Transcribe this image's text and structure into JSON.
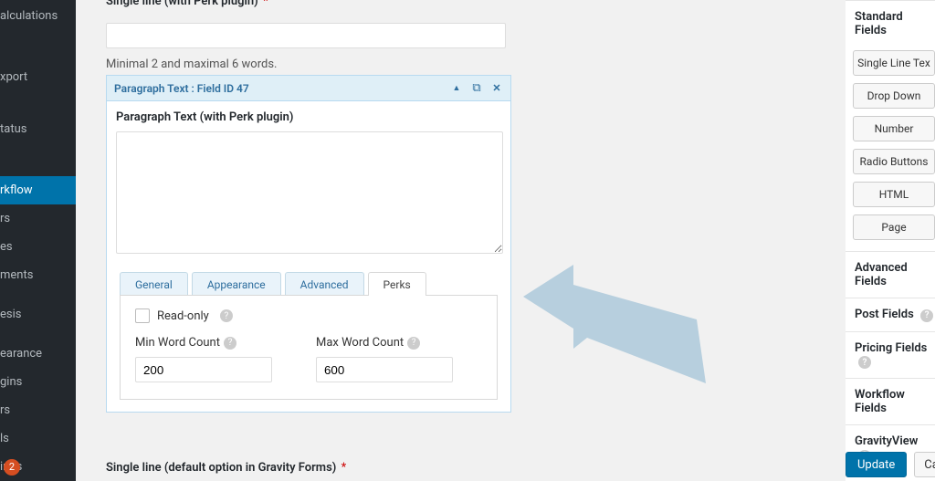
{
  "admin_menu": {
    "items": [
      {
        "label": "alculations"
      },
      {
        "label": "xport"
      },
      {
        "label": "tatus"
      },
      {
        "label": "rkflow",
        "active": true
      },
      {
        "label": "rs"
      },
      {
        "label": "es"
      },
      {
        "label": "ments"
      },
      {
        "label": "esis"
      },
      {
        "label": "earance"
      },
      {
        "label": "gins"
      },
      {
        "label": "rs"
      },
      {
        "label": "ls"
      },
      {
        "label": "ings"
      }
    ],
    "update_count": "2"
  },
  "top_field": {
    "label": "Single line (with Perk plugin)",
    "required": "*",
    "value": "",
    "helper": "Minimal 2 and maximal 6 words."
  },
  "card": {
    "header_title": "Paragraph Text : Field ID 47",
    "field_label": "Paragraph Text (with Perk plugin)",
    "textarea_value": ""
  },
  "tabs": {
    "items": [
      {
        "label": "General"
      },
      {
        "label": "Appearance"
      },
      {
        "label": "Advanced"
      },
      {
        "label": "Perks",
        "active": true
      }
    ]
  },
  "perks_panel": {
    "readonly_label": "Read-only",
    "min_label": "Min Word Count",
    "min_value": "200",
    "max_label": "Max Word Count",
    "max_value": "600"
  },
  "bottom_field": {
    "label": "Single line (default option in Gravity Forms)",
    "required": "*"
  },
  "right_panel": {
    "standard_header": "Standard Fields",
    "standard_buttons": [
      "Single Line Tex",
      "Drop Down",
      "Number",
      "Radio Buttons",
      "HTML",
      "Page"
    ],
    "advanced_header": "Advanced Fields",
    "post_header": "Post Fields",
    "pricing_header": "Pricing Fields",
    "workflow_header": "Workflow Fields",
    "gravityview_header": "GravityView",
    "update_label": "Update",
    "cancel_label": "Cancel"
  },
  "icons": {
    "collapse": "▲",
    "duplicate": "⧉",
    "close": "✕",
    "help": "?"
  },
  "colors": {
    "accent": "#0073aa",
    "arrow": "#b7cfde"
  }
}
